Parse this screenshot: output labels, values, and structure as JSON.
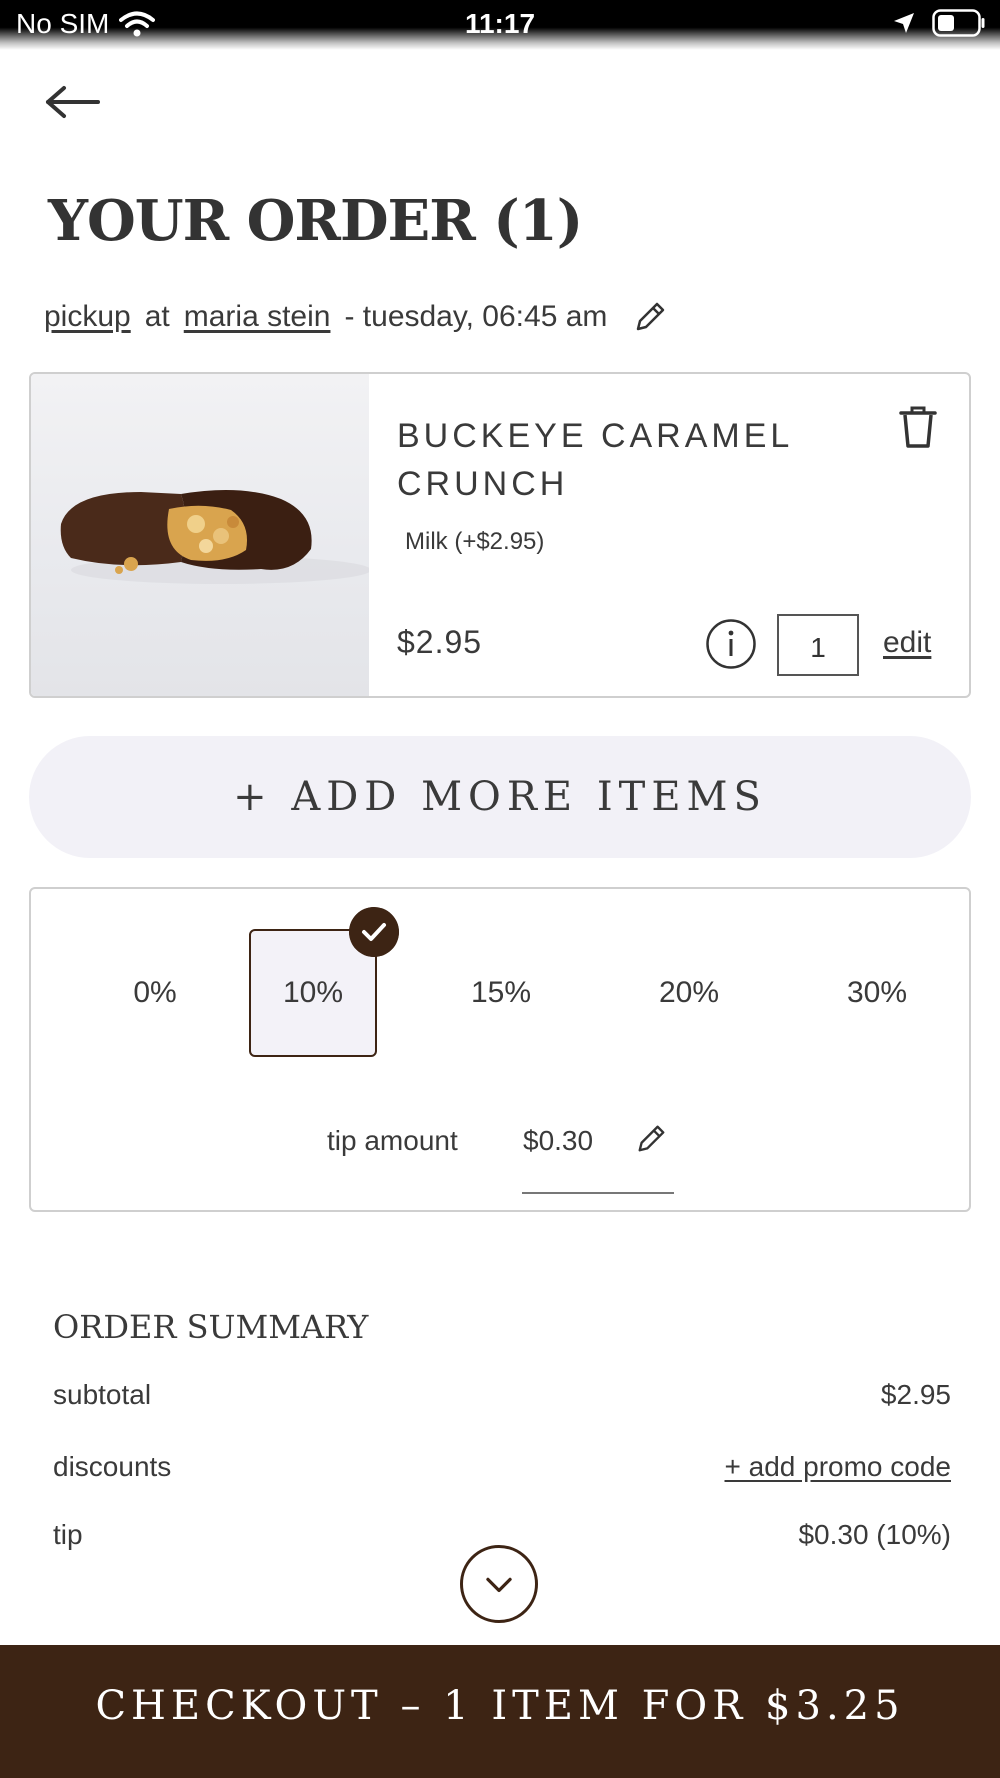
{
  "status_bar": {
    "carrier": "No SIM",
    "time": "11:17"
  },
  "page": {
    "title": "YOUR ORDER (1)"
  },
  "pickup": {
    "mode": "pickup",
    "at": "at",
    "location": "maria stein",
    "when": "- tuesday, 06:45 am"
  },
  "item": {
    "name": "BUCKEYE CARAMEL CRUNCH",
    "option": "Milk (+$2.95)",
    "price": "$2.95",
    "quantity": "1",
    "edit_label": "edit"
  },
  "add_more_label": "+ ADD MORE ITEMS",
  "tip": {
    "options": [
      "0%",
      "10%",
      "15%",
      "20%",
      "30%"
    ],
    "selected": "10%",
    "amount_label": "tip amount",
    "amount_value": "$0.30"
  },
  "summary": {
    "title": "ORDER SUMMARY",
    "subtotal_label": "subtotal",
    "subtotal_value": "$2.95",
    "discounts_label": "discounts",
    "promo_link": "+ add promo code",
    "tip_label": "tip",
    "tip_value": "$0.30 (10%)"
  },
  "checkout_label": "CHECKOUT – 1 ITEM FOR $3.25",
  "colors": {
    "brand_brown": "#3d2414",
    "pill_bg": "#f2f1f7",
    "text": "#3a3a3a"
  }
}
